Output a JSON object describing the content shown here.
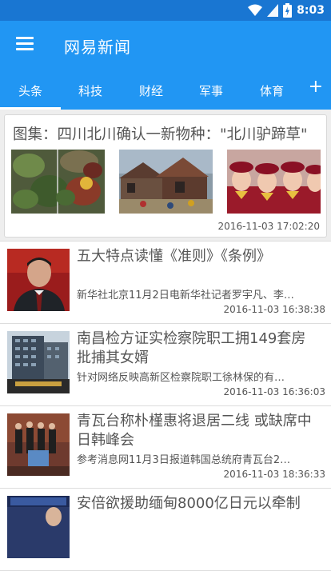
{
  "status_bar": {
    "time": "8:03",
    "icons": [
      "wifi-icon",
      "signal-icon",
      "battery-charging-icon"
    ]
  },
  "app_bar": {
    "title": "网易新闻",
    "menu_icon": "menu-icon"
  },
  "tabs": {
    "items": [
      {
        "label": "头条",
        "selected": true
      },
      {
        "label": "科技",
        "selected": false
      },
      {
        "label": "财经",
        "selected": false
      },
      {
        "label": "军事",
        "selected": false
      },
      {
        "label": "体育",
        "selected": false
      }
    ],
    "add_label": "+"
  },
  "gallery": {
    "title": "图集：四川北川确认一新物种：\"北川驴蹄草\"",
    "time": "2016-11-03 17:02:20"
  },
  "news": [
    {
      "title": "五大特点读懂《准则》《条例》",
      "summary": "新华社北京11月2日电新华社记者罗宇凡、李…",
      "time": "2016-11-03 16:38:38"
    },
    {
      "title": "南昌检方证实检察院职工拥149套房 批捕其女婿",
      "summary": "针对网络反映高新区检察院职工徐林保的有…",
      "time": "2016-11-03 16:36:03"
    },
    {
      "title": "青瓦台称朴槿惠将退居二线 或缺席中日韩峰会",
      "summary": "参考消息网11月3日报道韩国总统府青瓦台2…",
      "time": "2016-11-03 18:36:33"
    },
    {
      "title": "安倍欲援助缅甸8000亿日元以牵制",
      "summary": "",
      "time": ""
    }
  ],
  "colors": {
    "primary": "#2196f3",
    "status_bar": "#1976d2",
    "text": "#555555"
  }
}
